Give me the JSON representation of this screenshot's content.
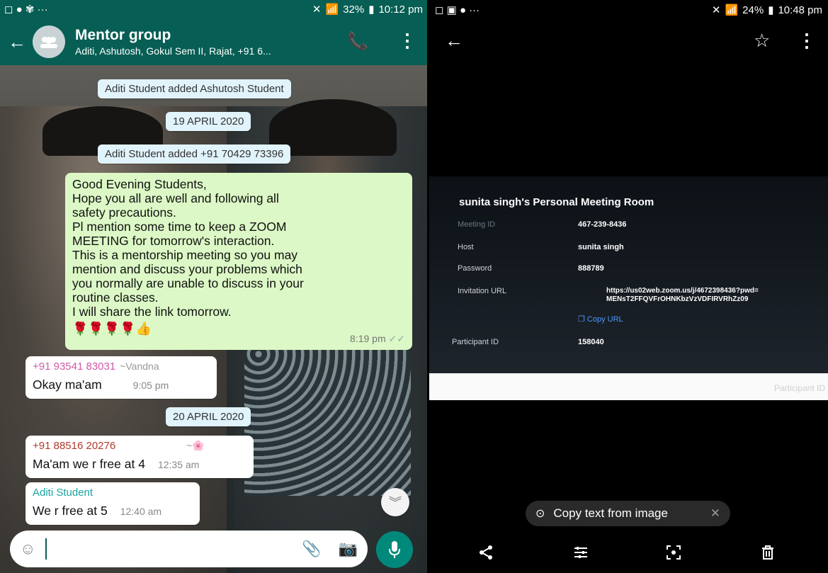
{
  "left": {
    "status": {
      "icons_left": "◻ ● ✾ ···",
      "battery": "32%",
      "time": "10:12 pm"
    },
    "header": {
      "title": "Mentor group",
      "subtitle": "Aditi, Ashutosh, Gokul Sem II, Rajat, +91 6..."
    },
    "system_messages": [
      "Aditi Student added Ashutosh Student",
      "19 APRIL 2020",
      "Aditi Student added +91 70429 73396",
      "20 APRIL 2020"
    ],
    "outgoing": {
      "lines": [
        "Good Evening Students,",
        "Hope you all are well and following all",
        "safety precautions.",
        "Pl mention some time to  keep a ZOOM",
        "MEETING for tomorrow's interaction.",
        "This is a mentorship meeting so you may",
        "mention and discuss your problems which",
        "you normally are unable to discuss in your",
        "routine classes.",
        "I will share the link tomorrow."
      ],
      "emoji": "🌹🌹🌹🌹👍",
      "time": "8:19 pm",
      "ticks": "✓✓"
    },
    "incoming": [
      {
        "sender": "+91 93541 83031",
        "alias": "~Vandna",
        "text": "Okay ma'am",
        "time": "9:05 pm",
        "color": "#d05aa8"
      },
      {
        "sender": "+91 88516 20276",
        "alias": "~🌸",
        "text": "Ma'am we r free at 4",
        "time": "12:35 am",
        "color": "#b03a2e"
      },
      {
        "sender": "Aditi Student",
        "alias": "",
        "text": "We r free at 5",
        "time": "12:40 am",
        "color": "#1ba3a0"
      }
    ],
    "accent": "#075e54",
    "outgoing_bg": "#dcf8c6"
  },
  "right": {
    "status": {
      "icons_left": "◻ ▣ ● ···",
      "battery": "24%",
      "time": "10:48 pm"
    },
    "photo": {
      "room_title": "sunita singh's Personal Meeting Room",
      "rows": [
        {
          "label": "Meeting ID",
          "value": "467-239-8436"
        },
        {
          "label": "Host",
          "value": "sunita singh"
        },
        {
          "label": "Password",
          "value": "888789"
        },
        {
          "label": "Invitation URL",
          "value": "https://us02web.zoom.us/j/4672398436?pwd=",
          "value2": "MENsT2FFQVFrOHNKbzVzVDFIRVRhZz09"
        },
        {
          "label": "Participant ID",
          "value": "158040"
        }
      ],
      "copy_url": "Copy URL",
      "watermark": "Participant ID"
    },
    "copy_chip": {
      "label": "Copy text from image"
    }
  }
}
